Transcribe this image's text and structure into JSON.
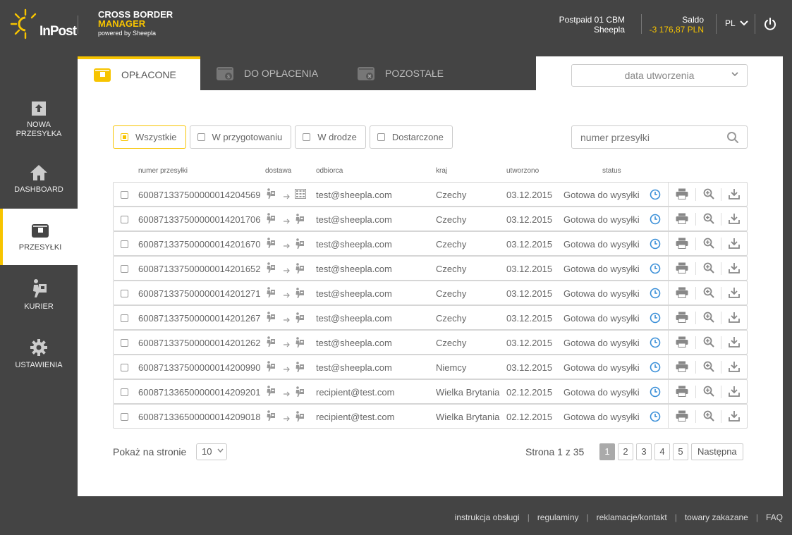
{
  "header": {
    "logo_text": "InPost",
    "brand_line1": "CROSS BORDER",
    "brand_line2": "MANAGER",
    "brand_line3": "powered by Sheepla",
    "account_line1": "Postpaid 01 CBM",
    "account_line2": "Sheepla",
    "saldo_label": "Saldo",
    "saldo_value": "-3 176,87 PLN",
    "language": "PL"
  },
  "sidebar": {
    "items": [
      {
        "label": "NOWA PRZESYŁKA",
        "icon": "upload-box-icon"
      },
      {
        "label": "DASHBOARD",
        "icon": "home-icon"
      },
      {
        "label": "PRZESYŁKI",
        "icon": "package-icon"
      },
      {
        "label": "KURIER",
        "icon": "courier-icon"
      },
      {
        "label": "USTAWIENIA",
        "icon": "gear-icon"
      }
    ]
  },
  "tabs": [
    {
      "label": "OPŁACONE"
    },
    {
      "label": "DO OPŁACENIA"
    },
    {
      "label": "POZOSTAŁE"
    }
  ],
  "date_select": "data utworzenia",
  "filters": [
    {
      "label": "Wszystkie"
    },
    {
      "label": "W przygotowaniu"
    },
    {
      "label": "W drodze"
    },
    {
      "label": "Dostarczone"
    }
  ],
  "search_placeholder": "numer przesyłki",
  "columns": {
    "number": "numer przesyłki",
    "delivery": "dostawa",
    "recipient": "odbiorca",
    "country": "kraj",
    "created": "utworzono",
    "status": "status"
  },
  "rows": [
    {
      "number": "600871337500000014204569",
      "recipient": "test@sheepla.com",
      "country": "Czechy",
      "created": "03.12.2015",
      "status": "Gotowa do wysyłki",
      "delivery_to": "locker"
    },
    {
      "number": "600871337500000014201706",
      "recipient": "test@sheepla.com",
      "country": "Czechy",
      "created": "03.12.2015",
      "status": "Gotowa do wysyłki",
      "delivery_to": "courier"
    },
    {
      "number": "600871337500000014201670",
      "recipient": "test@sheepla.com",
      "country": "Czechy",
      "created": "03.12.2015",
      "status": "Gotowa do wysyłki",
      "delivery_to": "courier"
    },
    {
      "number": "600871337500000014201652",
      "recipient": "test@sheepla.com",
      "country": "Czechy",
      "created": "03.12.2015",
      "status": "Gotowa do wysyłki",
      "delivery_to": "courier"
    },
    {
      "number": "600871337500000014201271",
      "recipient": "test@sheepla.com",
      "country": "Czechy",
      "created": "03.12.2015",
      "status": "Gotowa do wysyłki",
      "delivery_to": "courier"
    },
    {
      "number": "600871337500000014201267",
      "recipient": "test@sheepla.com",
      "country": "Czechy",
      "created": "03.12.2015",
      "status": "Gotowa do wysyłki",
      "delivery_to": "courier"
    },
    {
      "number": "600871337500000014201262",
      "recipient": "test@sheepla.com",
      "country": "Czechy",
      "created": "03.12.2015",
      "status": "Gotowa do wysyłki",
      "delivery_to": "courier"
    },
    {
      "number": "600871337500000014200990",
      "recipient": "test@sheepla.com",
      "country": "Niemcy",
      "created": "03.12.2015",
      "status": "Gotowa do wysyłki",
      "delivery_to": "courier"
    },
    {
      "number": "600871336500000014209201",
      "recipient": "recipient@test.com",
      "country": "Wielka Brytania",
      "created": "02.12.2015",
      "status": "Gotowa do wysyłki",
      "delivery_to": "courier"
    },
    {
      "number": "600871336500000014209018",
      "recipient": "recipient@test.com",
      "country": "Wielka Brytania",
      "created": "02.12.2015",
      "status": "Gotowa do wysyłki",
      "delivery_to": "courier"
    }
  ],
  "pagination": {
    "per_page_label": "Pokaż na stronie",
    "per_page_value": "10",
    "page_info": "Strona 1 z 35",
    "pages": [
      "1",
      "2",
      "3",
      "4",
      "5"
    ],
    "next_label": "Następna"
  },
  "footer_links": [
    "instrukcja obsługi",
    "regulaminy",
    "reklamacje/kontakt",
    "towary zakazane",
    "FAQ"
  ],
  "colors": {
    "accent": "#f7c400",
    "background": "#444444",
    "clock_blue": "#3a8fd8"
  }
}
